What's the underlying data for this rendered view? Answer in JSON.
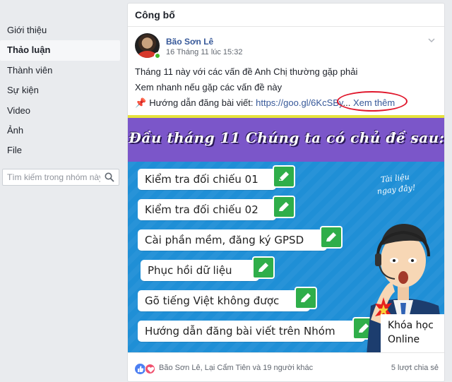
{
  "sidebar": {
    "items": [
      {
        "label": "Giới thiệu",
        "active": false
      },
      {
        "label": "Thảo luận",
        "active": true
      },
      {
        "label": "Thành viên",
        "active": false
      },
      {
        "label": "Sự kiện",
        "active": false
      },
      {
        "label": "Video",
        "active": false
      },
      {
        "label": "Ảnh",
        "active": false
      },
      {
        "label": "File",
        "active": false
      }
    ],
    "search_placeholder": "Tìm kiếm trong nhóm này",
    "search_icon": "search-icon"
  },
  "card": {
    "header": "Công bố"
  },
  "post": {
    "author": "Bão Sơn Lê",
    "timestamp": "16 Tháng 11 lúc 15:32",
    "line1": "Tháng 11 này với các vấn đề Anh Chị thường gặp phải",
    "line2": "Xem nhanh nếu gặp các vấn đề này",
    "pin": "📌",
    "line3_prefix": "Hướng dẫn đăng bài viết: ",
    "link": "https://goo.gl/6KcSBy",
    "ellipsis": "...",
    "see_more": "Xem thêm"
  },
  "banner": {
    "title": "Đầu tháng 11 Chúng ta có chủ đề sau:",
    "topics": [
      "Kiểm tra đối chiếu 01",
      "Kiểm tra đối chiếu 02",
      "Cài phần mềm, đăng ký GPSD",
      "Phục hồi dữ liệu",
      "Gõ tiếng Việt không được",
      "Hướng dẫn đăng bài viết trên Nhóm"
    ],
    "note_line1": "Tài liệu",
    "note_line2": "ngay đây!",
    "course_line1": "Khóa học",
    "course_line2": "Online"
  },
  "footer": {
    "reactors": "Bão Sơn Lê, Lại Cẩm Tiên và 19 người khác",
    "shares": "5 lượt chia sẻ"
  },
  "colors": {
    "link": "#365899",
    "banner_blue": "#1f8fd6",
    "banner_purple": "#7b56c9",
    "pencil_green": "#2fae4a",
    "annotation_red": "#e0162b"
  }
}
